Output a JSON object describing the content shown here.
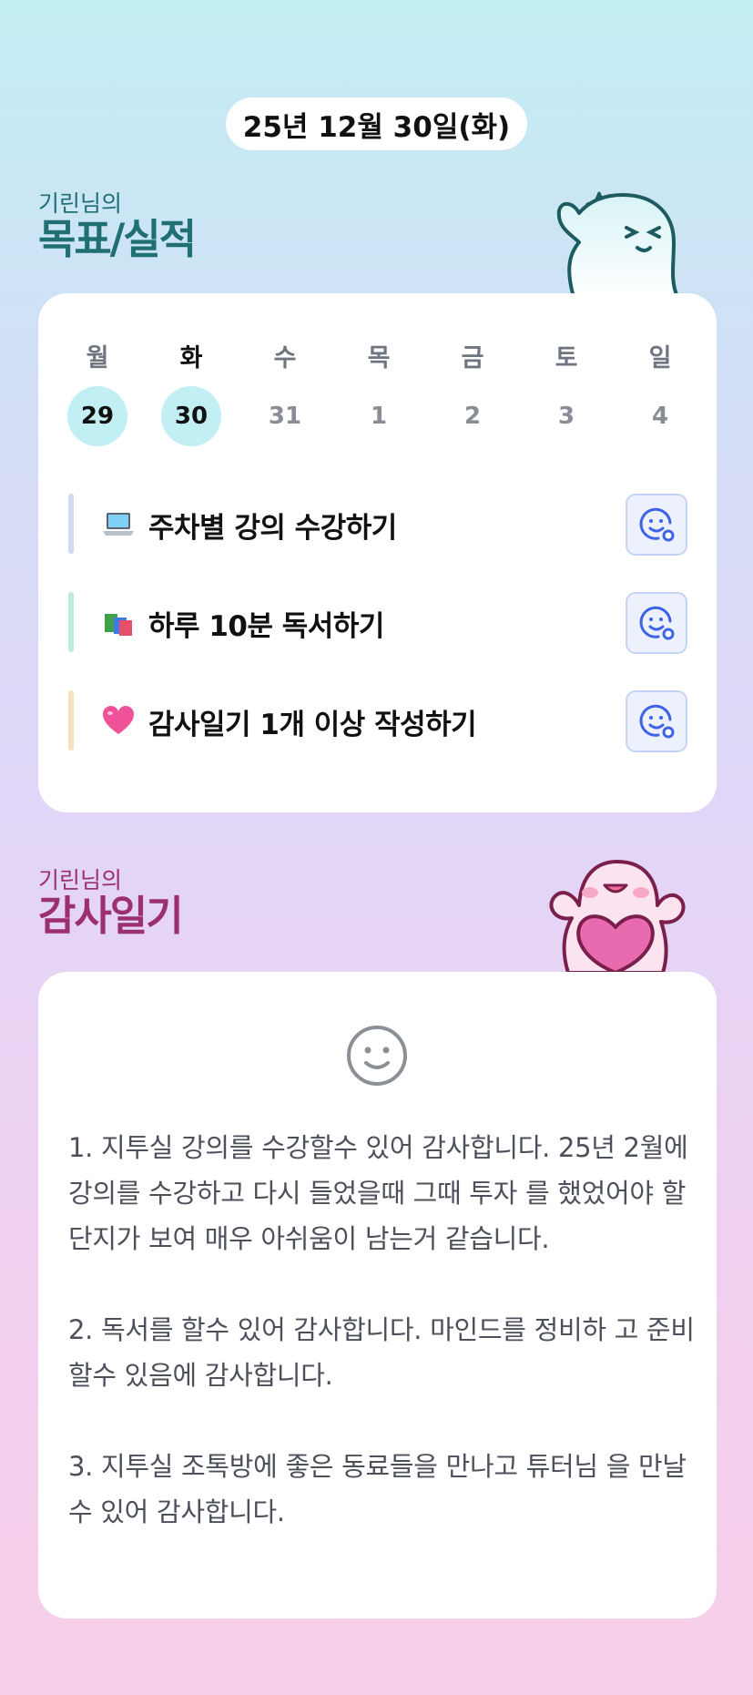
{
  "header": {
    "date": "25년 12월 30일(화)"
  },
  "goals_section": {
    "subtitle": "기린님의",
    "title": "목표/실적",
    "week": [
      {
        "day": "월",
        "date": "29",
        "done": true
      },
      {
        "day": "화",
        "date": "30",
        "done": true
      },
      {
        "day": "수",
        "date": "31",
        "done": false
      },
      {
        "day": "목",
        "date": "1",
        "done": false
      },
      {
        "day": "금",
        "date": "2",
        "done": false
      },
      {
        "day": "토",
        "date": "3",
        "done": false
      },
      {
        "day": "일",
        "date": "4",
        "done": false
      }
    ],
    "current_day": "화",
    "goals": [
      {
        "icon": "laptop-icon",
        "label": "주차별 강의 수강하기",
        "accent": "#d2d9f6"
      },
      {
        "icon": "books-icon",
        "label": "하루 10분 독서하기",
        "accent": "#bdebd9"
      },
      {
        "icon": "pink-heart-icon",
        "label": "감사일기 1개 이상 작성하기",
        "accent": "#fbe0bf"
      }
    ]
  },
  "gratitude_section": {
    "subtitle": "기린님의",
    "title": "감사일기",
    "text": "1. 지투실 강의를 수강할수 있어 감사합니다. 25년 2월에 강의를 수강하고 다시 들었을때 그때 투자 를 했었어야 할 단지가 보여 매우 아쉬움이 남는거 같습니다.\n\n2. 독서를 할수 있어 감사합니다. 마인드를 정비하 고 준비 할수 있음에 감사합니다.\n\n3. 지투실 조톡방에 좋은 동료들을 만나고 튜터님 을 만날수 있어 감사합니다."
  },
  "colors": {
    "goal_title": "#1f6f73",
    "gratitude_title": "#9c2f6d",
    "done_circle": "#c1eff3",
    "react_button_bg": "#edf1fd",
    "react_icon": "#3d63e6"
  }
}
